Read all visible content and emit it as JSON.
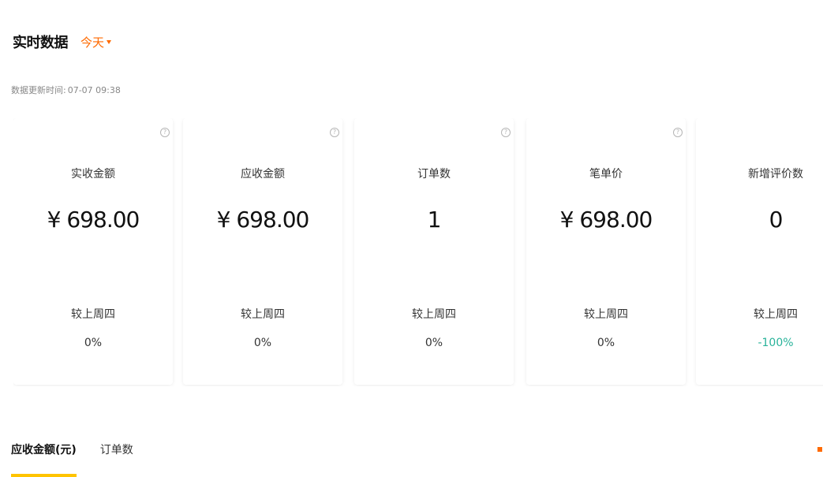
{
  "header": {
    "title": "实时数据",
    "period": "今天"
  },
  "update": {
    "label": "数据更新时间:",
    "time": "07-07 09:38"
  },
  "cards": [
    {
      "label": "实收金额",
      "value": "¥ 698.00",
      "compare_label": "较上周四",
      "compare_value": "0%"
    },
    {
      "label": "应收金额",
      "value": "¥ 698.00",
      "compare_label": "较上周四",
      "compare_value": "0%"
    },
    {
      "label": "订单数",
      "value": "1",
      "compare_label": "较上周四",
      "compare_value": "0%"
    },
    {
      "label": "笔单价",
      "value": "¥ 698.00",
      "compare_label": "较上周四",
      "compare_value": "0%"
    },
    {
      "label": "新增评价数",
      "value": "0",
      "compare_label": "较上周四",
      "compare_value": "-100%"
    }
  ],
  "help_icon_glyph": "?",
  "tabs": [
    {
      "label": "应收金额(元)",
      "active": true
    },
    {
      "label": "订单数",
      "active": false
    }
  ],
  "colors": {
    "accent": "#ff6a00",
    "tab_indicator": "#ffc400",
    "negative_change": "#29b39a"
  },
  "icons": {
    "period_dropdown": "caret-down-icon",
    "metric_help": "question-circle-icon",
    "chart_legend": "legend-square-icon"
  }
}
